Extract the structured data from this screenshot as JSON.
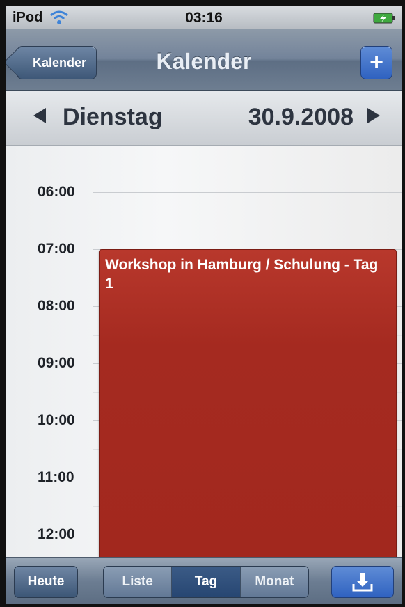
{
  "status": {
    "carrier": "iPod",
    "time": "03:16"
  },
  "nav": {
    "back_label": "Kalender",
    "title": "Kalender",
    "add_label": "+"
  },
  "date": {
    "day_name": "Dienstag",
    "date_value": "30.9.2008"
  },
  "timeline": {
    "hours": [
      "06:00",
      "07:00",
      "08:00",
      "09:00",
      "10:00",
      "11:00",
      "12:00"
    ]
  },
  "event": {
    "title": "Workshop in Hamburg / Schulung - Tag 1",
    "color": "#a52a20"
  },
  "toolbar": {
    "today_label": "Heute",
    "segments": [
      "Liste",
      "Tag",
      "Monat"
    ],
    "active_segment": "Tag"
  },
  "colors": {
    "nav_bar": "#73839a",
    "event_red": "#a52a20",
    "accent_blue": "#2f62c0"
  }
}
